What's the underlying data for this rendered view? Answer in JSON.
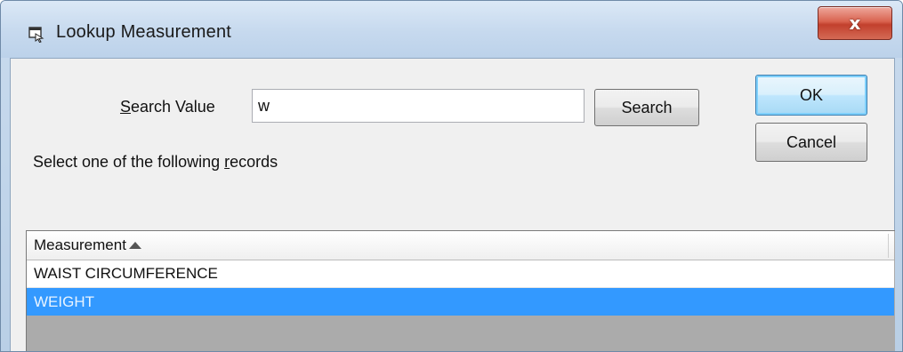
{
  "window": {
    "title": "Lookup Measurement",
    "close_label": "x"
  },
  "search": {
    "label_prefix": "",
    "label_accel": "S",
    "label_rest": "earch Value",
    "value": "w",
    "button_label": "Search"
  },
  "buttons": {
    "ok_label": "OK",
    "cancel_label": "Cancel"
  },
  "records": {
    "label_before": "Select one of the following ",
    "label_accel": "r",
    "label_after": "ecords"
  },
  "grid": {
    "column_header": "Measurement",
    "sort": "ascending",
    "rows": [
      {
        "label": "WAIST CIRCUMFERENCE",
        "selected": false
      },
      {
        "label": "WEIGHT",
        "selected": true
      }
    ]
  },
  "colors": {
    "selection": "#3399ff",
    "close_button": "#c2402d",
    "default_button_border": "#3c7fb1"
  }
}
